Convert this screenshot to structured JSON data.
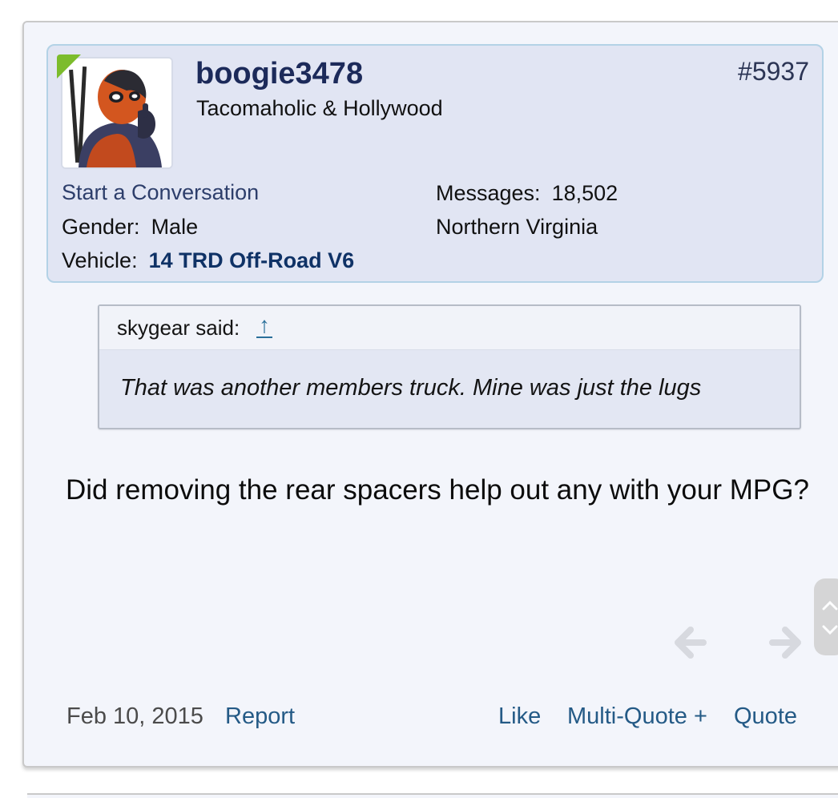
{
  "post": {
    "user": {
      "username": "boogie3478",
      "title": "Tacomaholic & Hollywood",
      "start_conversation": "Start a Conversation",
      "gender_label": "Gender:",
      "gender_value": "Male",
      "vehicle_label": "Vehicle:",
      "vehicle_value": "14 TRD Off-Road V6",
      "messages_label": "Messages:",
      "messages_value": "18,502",
      "location": "Northern Virginia"
    },
    "post_number": "#5937",
    "quote": {
      "author": "skygear said:",
      "jump_icon": "↑",
      "text": "That was another members truck. Mine was just the lugs"
    },
    "message": "Did removing the rear spacers help out any with your MPG?",
    "footer": {
      "date": "Feb 10, 2015",
      "report": "Report",
      "like": "Like",
      "multi_quote": "Multi-Quote +",
      "quote": "Quote"
    }
  },
  "colors": {
    "online_badge": "#7cbc2c",
    "link": "#245a86",
    "username": "#1c2a5a",
    "user_info_bg": "#e1e5f3"
  },
  "icons": {
    "avatar": "deadpool-avatar",
    "prev": "arrow-left-icon",
    "next": "arrow-right-icon",
    "scroll_up": "chevron-up-icon",
    "scroll_down": "chevron-down-icon"
  }
}
